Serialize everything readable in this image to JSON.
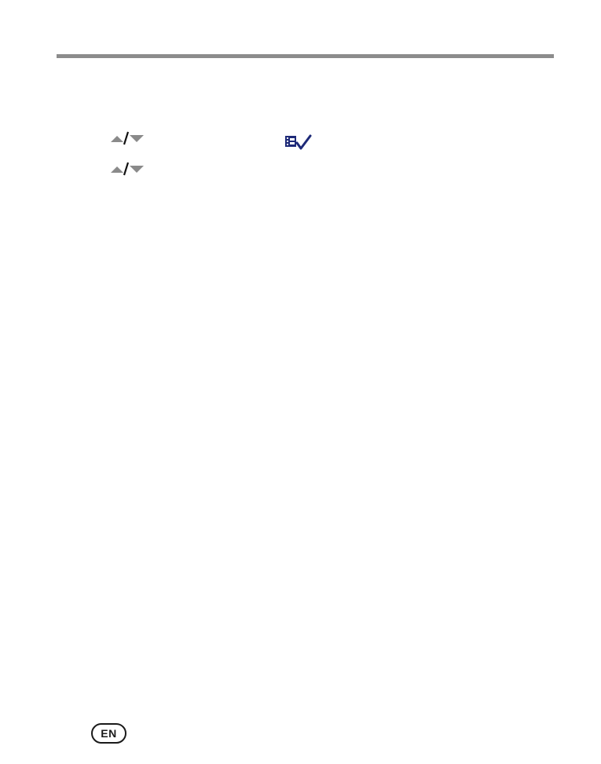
{
  "header": {
    "rule_color": "#8c8c8c"
  },
  "steps": [
    {
      "icon": "up-down-arrows-icon"
    },
    {
      "icon": "up-down-arrows-icon"
    }
  ],
  "inline_icons": {
    "review": "review-checkmark-icon",
    "color": "#1e2a78"
  },
  "footer": {
    "language_badge": "EN"
  }
}
